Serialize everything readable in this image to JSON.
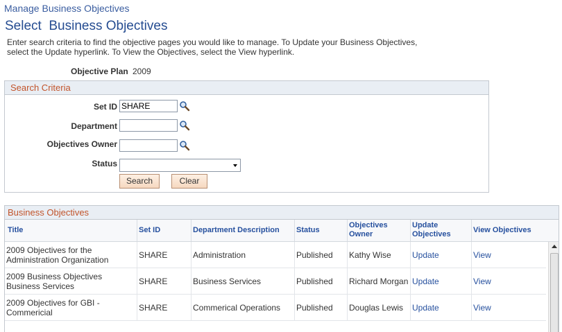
{
  "breadcrumb": "Manage Business Objectives",
  "page_title": "Select  Business Objectives",
  "instructions": [
    "Enter search criteria to find the objective pages you would like to manage. To Update your Business Objectives,",
    "select the Update hyperlink. To View the Objectives, select the View hyperlink."
  ],
  "objective_plan": {
    "label": "Objective Plan",
    "value": "2009"
  },
  "search": {
    "header": "Search Criteria",
    "set_id": {
      "label": "Set ID",
      "value": "SHARE"
    },
    "department": {
      "label": "Department",
      "value": ""
    },
    "owner": {
      "label": "Objectives Owner",
      "value": ""
    },
    "status": {
      "label": "Status",
      "value": ""
    },
    "search_button": "Search",
    "clear_button": "Clear"
  },
  "grid": {
    "header": "Business Objectives",
    "columns": [
      "Title",
      "Set ID",
      "Department Description",
      "Status",
      "Objectives Owner",
      "Update Objectives",
      "View Objectives"
    ],
    "rows": [
      {
        "title": "2009 Objectives for the Administration Organization",
        "set_id": "SHARE",
        "dept": "Administration",
        "status": "Published",
        "owner": "Kathy Wise",
        "update": "Update",
        "view": "View"
      },
      {
        "title": "2009 Business Objectives Business Services",
        "set_id": "SHARE",
        "dept": "Business Services",
        "status": "Published",
        "owner": "Richard Morgan",
        "update": "Update",
        "view": "View"
      },
      {
        "title": "2009 Objectives for GBI - Commericial",
        "set_id": "SHARE",
        "dept": "Commerical Operations",
        "status": "Published",
        "owner": "Douglas Lewis",
        "update": "Update",
        "view": "View"
      }
    ]
  },
  "icons": {
    "lookup": "magnifier-lookup-icon",
    "dropdown": "chevron-down-icon",
    "scroll_up": "scroll-up-arrow-icon"
  },
  "colors": {
    "title_blue": "#254c91",
    "link_blue": "#26509e",
    "section_orange": "#c2542b",
    "header_bg": "#e9eef4"
  }
}
